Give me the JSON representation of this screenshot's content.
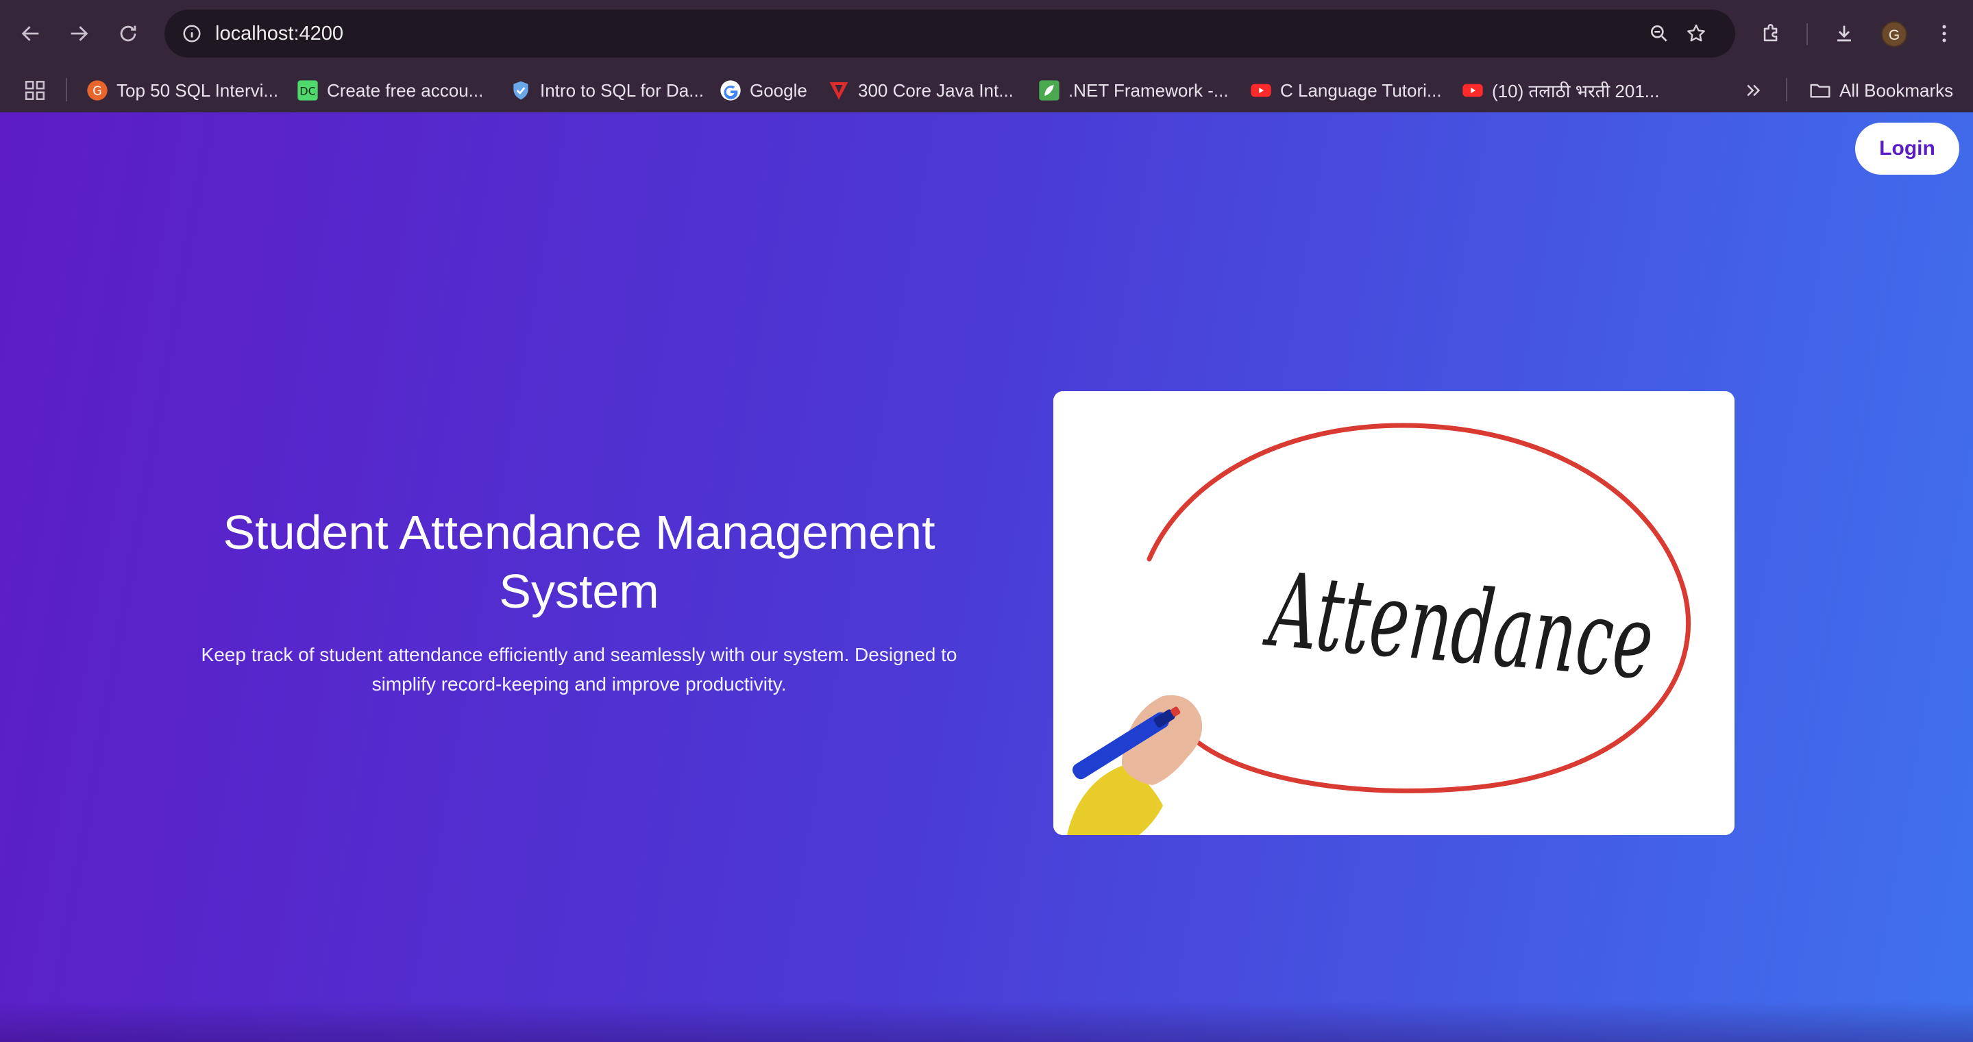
{
  "browser": {
    "url": "localhost:4200",
    "avatar_initial": "G",
    "all_bookmarks_label": "All Bookmarks",
    "bookmarks": [
      {
        "label": "Top 50 SQL Intervi...",
        "icon": "orange-circle-icon"
      },
      {
        "label": "Create free accou...",
        "icon": "datacamp-icon"
      },
      {
        "label": "Intro to SQL for Da...",
        "icon": "shield-icon"
      },
      {
        "label": "Google",
        "icon": "google-icon"
      },
      {
        "label": "300 Core Java Int...",
        "icon": "red-v-icon"
      },
      {
        "label": ".NET Framework -...",
        "icon": "green-leaf-icon"
      },
      {
        "label": "C Language Tutori...",
        "icon": "youtube-icon"
      },
      {
        "label": "(10) तलाठी भरती 201...",
        "icon": "youtube-icon"
      }
    ]
  },
  "page": {
    "login_label": "Login",
    "title": "Student Attendance Management System",
    "subtitle": "Keep track of student attendance efficiently and seamlessly with our system. Designed to simplify record-keeping and improve productivity.",
    "image_text": "Attendance"
  },
  "colors": {
    "gradient_start": "#5d1cc6",
    "gradient_end": "#3f72ee",
    "login_text": "#5a1cc4",
    "circle_red": "#d93a32",
    "marker_blue": "#1f3fd0",
    "sleeve_yellow": "#e8cd2a"
  }
}
